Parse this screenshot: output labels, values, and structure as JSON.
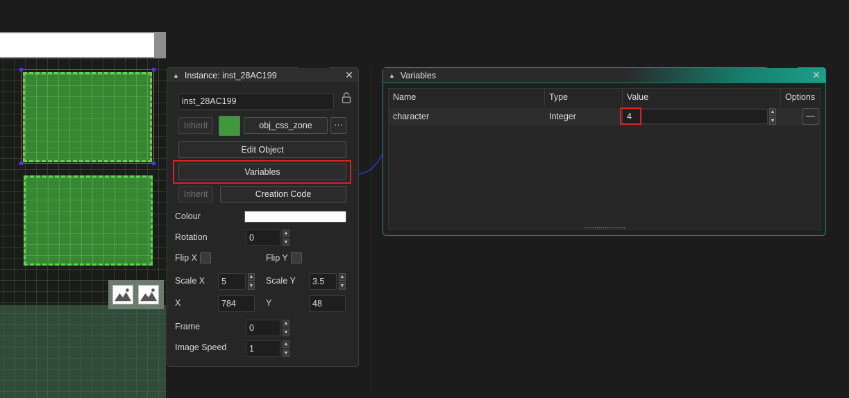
{
  "instance_panel": {
    "title": "Instance: inst_28AC199",
    "name_value": "inst_28AC199",
    "inherit_label": "Inherit",
    "object_name": "obj_css_zone",
    "more_label": "···",
    "object_color": "#3c9a3a",
    "edit_object_label": "Edit Object",
    "variables_label": "Variables",
    "inherit_label_2": "Inherit",
    "creation_code_label": "Creation Code",
    "colour_label": "Colour",
    "colour_value": "#ffffff",
    "rotation_label": "Rotation",
    "rotation_value": "0",
    "flip_x_label": "Flip X",
    "flip_y_label": "Flip Y",
    "scale_x_label": "Scale X",
    "scale_x_value": "5",
    "scale_y_label": "Scale Y",
    "scale_y_value": "3.5",
    "x_label": "X",
    "x_value": "784",
    "y_label": "Y",
    "y_value": "48",
    "frame_label": "Frame",
    "frame_value": "0",
    "image_speed_label": "Image Speed",
    "image_speed_value": "1"
  },
  "variables_panel": {
    "title": "Variables",
    "columns": [
      "Name",
      "Type",
      "Value",
      "Options"
    ],
    "rows": [
      {
        "name": "character",
        "type": "Integer",
        "value": "4"
      }
    ],
    "remove_label": "—"
  },
  "icons": {
    "collapse": "▲",
    "close": "✕",
    "lock": "lock-icon",
    "spin_up": "▲",
    "spin_down": "▼"
  },
  "colors": {
    "accent_teal": "#1aa08a",
    "highlight_red": "#e02020",
    "zone_green": "#3ca037"
  }
}
